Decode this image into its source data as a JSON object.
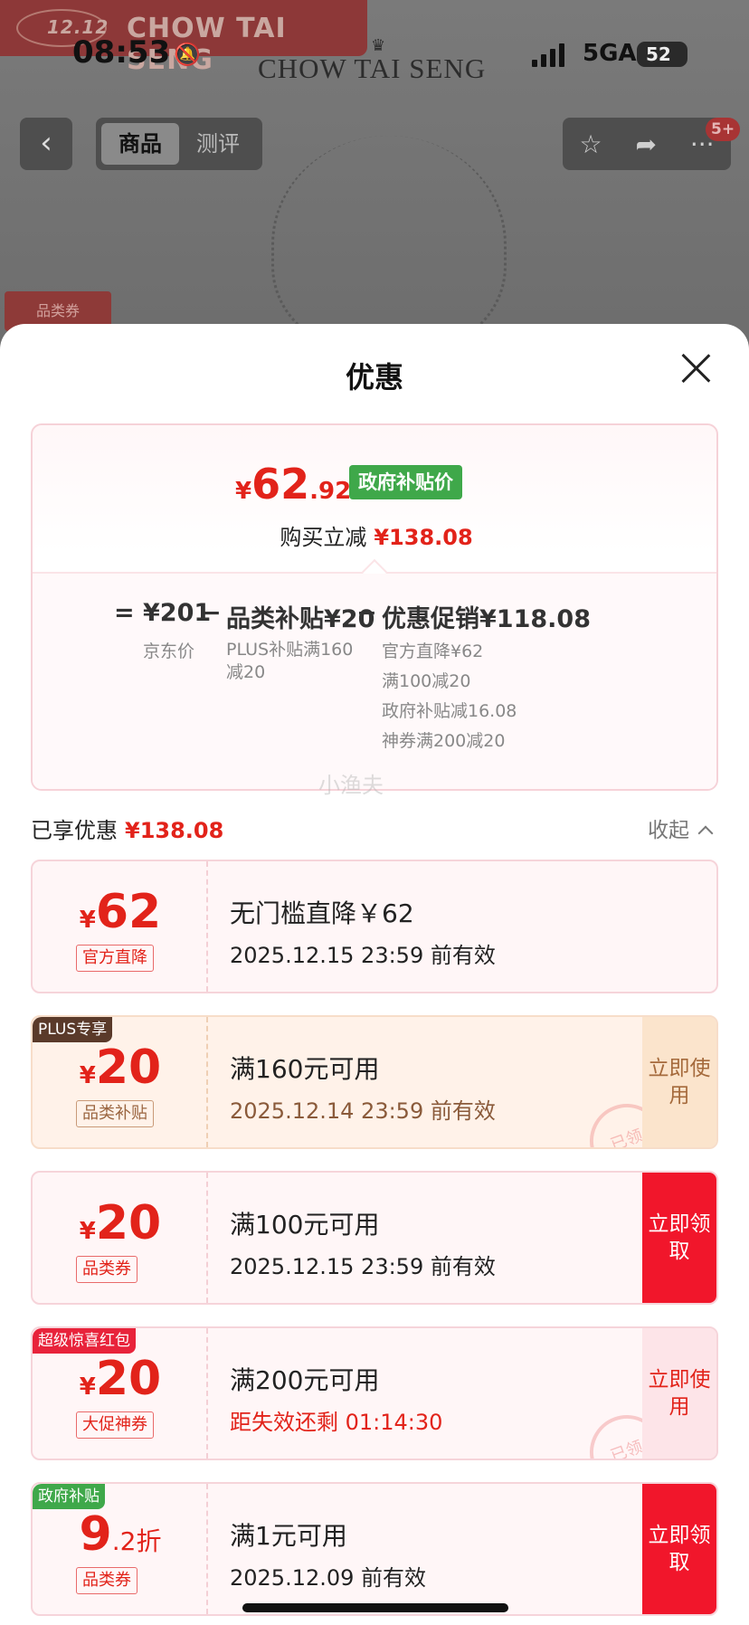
{
  "status_bar": {
    "time": "08:53",
    "network": "5GA",
    "battery": "52"
  },
  "background": {
    "badge_1212": "CHOW TAI SENG",
    "badge_1212_mini": "12.12",
    "brand": "CHOW TAI SENG",
    "category_pill": "品类券"
  },
  "nav": {
    "tabs": [
      {
        "label": "商品"
      },
      {
        "label": "测评"
      }
    ],
    "cart_badge": "5+"
  },
  "sheet": {
    "title": "优惠",
    "summary": {
      "price_symbol": "¥",
      "price_int": "62",
      "price_dec": ".92",
      "tag": "政府补贴价",
      "save_label": "购买立减",
      "save_amount": "¥138.08",
      "eq_sign": "=",
      "minus_sign": "−",
      "jd_price": "¥201",
      "jd_price_label": "京东价",
      "category_subsidy": "品类补贴¥20",
      "category_subsidy_desc": [
        "PLUS补贴满160",
        "减20"
      ],
      "promo": "优惠促销¥118.08",
      "promo_details": [
        "官方直降¥62",
        "满100减20",
        "政府补贴减16.08",
        "神券满200减20"
      ]
    },
    "watermark": "小渔夫",
    "enjoyed": {
      "label": "已享优惠",
      "amount": "¥138.08",
      "collapse": "收起"
    },
    "coupons": [
      {
        "symbol": "¥",
        "amount": "62",
        "suffix": "",
        "label": "官方直降",
        "corner": "",
        "title": "无门槛直降￥62",
        "subtitle": "2025.12.15 23:59 前有效",
        "action": ""
      },
      {
        "symbol": "¥",
        "amount": "20",
        "suffix": "",
        "label": "品类补贴",
        "corner": "PLUS专享",
        "title": "满160元可用",
        "subtitle": "2025.12.14 23:59 前有效",
        "action": "立即使用",
        "stamp": "已领"
      },
      {
        "symbol": "¥",
        "amount": "20",
        "suffix": "",
        "label": "品类券",
        "corner": "",
        "title": "满100元可用",
        "subtitle": "2025.12.15 23:59 前有效",
        "action": "立即领取"
      },
      {
        "symbol": "¥",
        "amount": "20",
        "suffix": "",
        "label": "大促神券",
        "corner": "超级惊喜红包",
        "title": "满200元可用",
        "subtitle": "距失效还剩 01:14:30",
        "action": "立即使用",
        "stamp": "已领"
      },
      {
        "symbol": "",
        "amount": "9",
        "suffix": ".2折",
        "label": "品类券",
        "corner": "政府补贴",
        "title": "满1元可用",
        "subtitle": "2025.12.09 前有效",
        "action": "立即领取"
      }
    ]
  },
  "colors": {
    "accent_red": "#e2231a",
    "gov_green": "#3fa84a",
    "plus_brown": "#5a3a2a",
    "surprise_red": "#e8233b"
  }
}
